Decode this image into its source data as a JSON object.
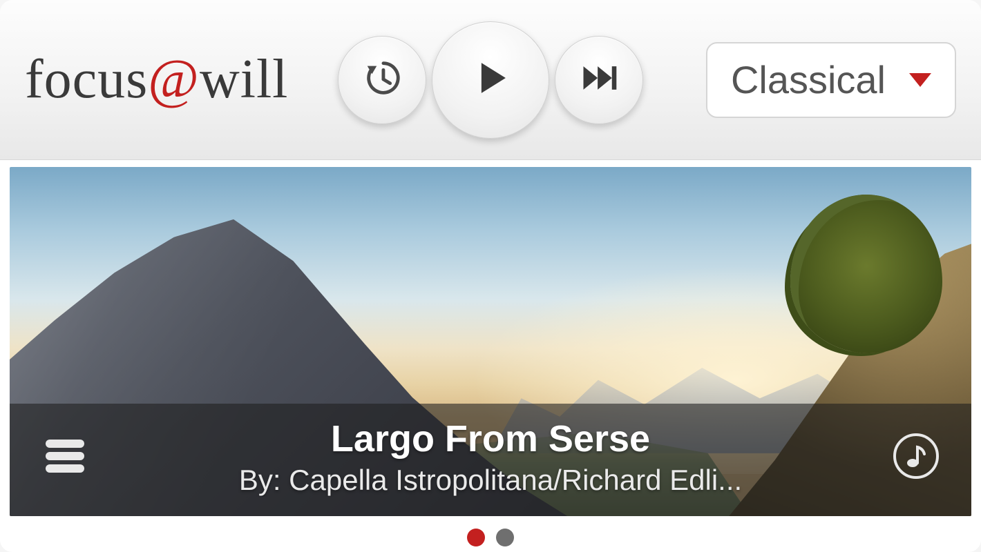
{
  "brand": {
    "pre": "focus",
    "at": "@",
    "post": "will"
  },
  "genre": {
    "selected": "Classical"
  },
  "track": {
    "title": "Largo From Serse",
    "byline": "By: Capella Istropolitana/Richard Edli..."
  },
  "pager": {
    "count": 2,
    "active_index": 0
  },
  "colors": {
    "accent": "#c3201f"
  }
}
